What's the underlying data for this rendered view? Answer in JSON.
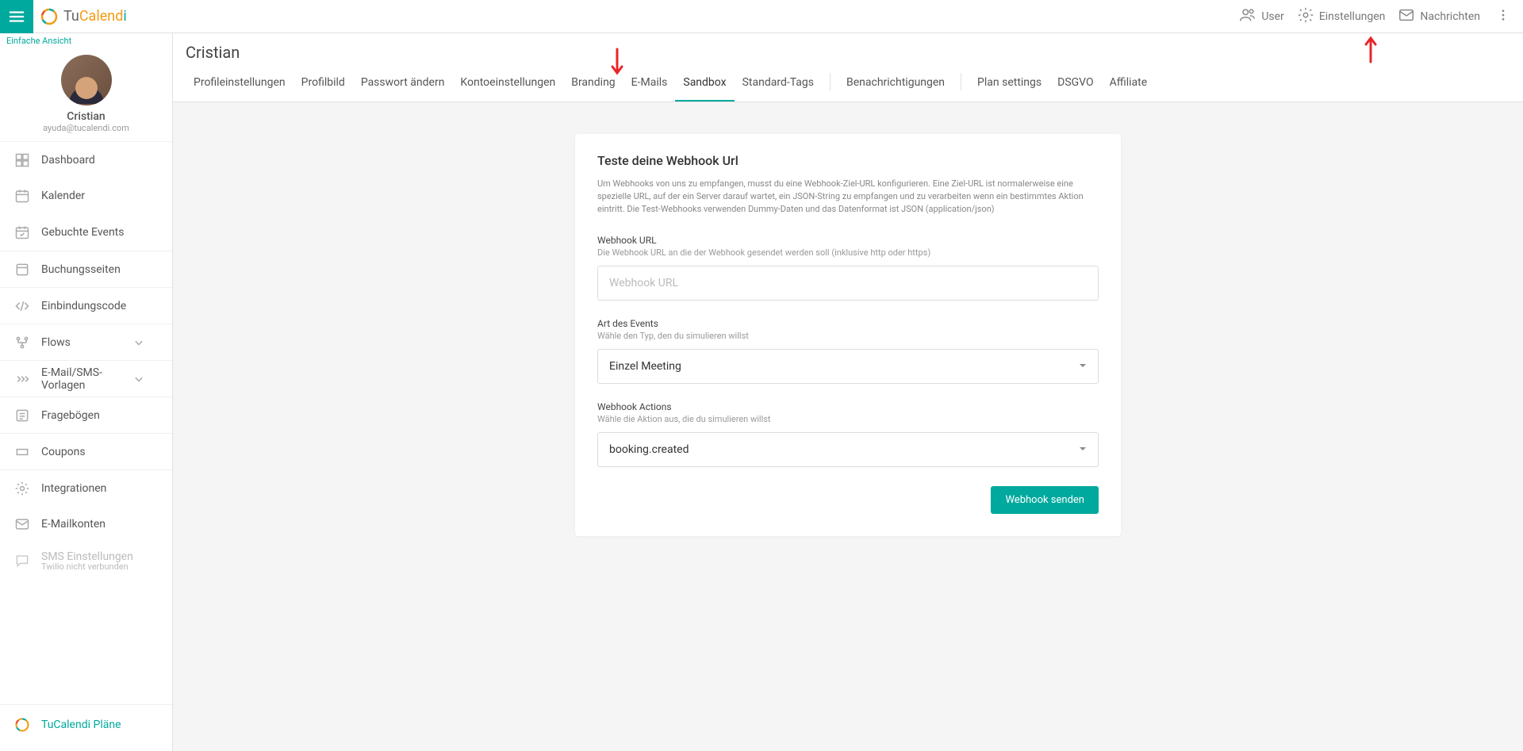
{
  "topbar": {
    "logo_tu": "Tu",
    "logo_calend": "Calend",
    "logo_i": "i",
    "user": "User",
    "settings": "Einstellungen",
    "messages": "Nachrichten"
  },
  "sidebar": {
    "easy_view": "Einfache Ansicht",
    "profile": {
      "name": "Cristian",
      "email": "ayuda@tucalendi.com"
    },
    "items": [
      {
        "label": "Dashboard"
      },
      {
        "label": "Kalender"
      },
      {
        "label": "Gebuchte Events"
      },
      {
        "label": "Buchungsseiten"
      },
      {
        "label": "Einbindungscode"
      },
      {
        "label": "Flows"
      },
      {
        "label": "E-Mail/SMS-Vorlagen"
      },
      {
        "label": "Fragebögen"
      },
      {
        "label": "Coupons"
      },
      {
        "label": "Integrationen"
      },
      {
        "label": "E-Mailkonten"
      },
      {
        "label": "SMS Einstellungen",
        "sub": "Twilio nicht verbunden"
      }
    ],
    "plans": "TuCalendi Pläne"
  },
  "header": {
    "title": "Cristian",
    "tabs": [
      "Profileinstellungen",
      "Profilbild",
      "Passwort ändern",
      "Kontoeinstellungen",
      "Branding",
      "E-Mails",
      "Sandbox",
      "Standard-Tags",
      "Benachrichtigungen",
      "Plan settings",
      "DSGVO",
      "Affiliate"
    ]
  },
  "card": {
    "title": "Teste deine Webhook Url",
    "desc": "Um Webhooks von uns zu empfangen, musst du eine Webhook-Ziel-URL konfigurieren. Eine Ziel-URL ist normalerweise eine spezielle URL, auf der ein Server darauf wartet, ein JSON-String zu empfangen und zu verarbeiten wenn ein bestimmtes Aktion eintritt. Die Test-Webhooks verwenden Dummy-Daten und das Datenformat ist JSON (application/json)",
    "url_label": "Webhook URL",
    "url_hint": "Die Webhook URL an die der Webhook gesendet werden soll (inklusive http oder https)",
    "url_placeholder": "Webhook URL",
    "eventtype_label": "Art des Events",
    "eventtype_hint": "Wähle den Typ, den du simulieren willst",
    "eventtype_value": "Einzel Meeting",
    "actions_label": "Webhook Actions",
    "actions_hint": "Wähle die Aktion aus, die du simulieren willst",
    "actions_value": "booking.created",
    "send_btn": "Webhook senden"
  }
}
